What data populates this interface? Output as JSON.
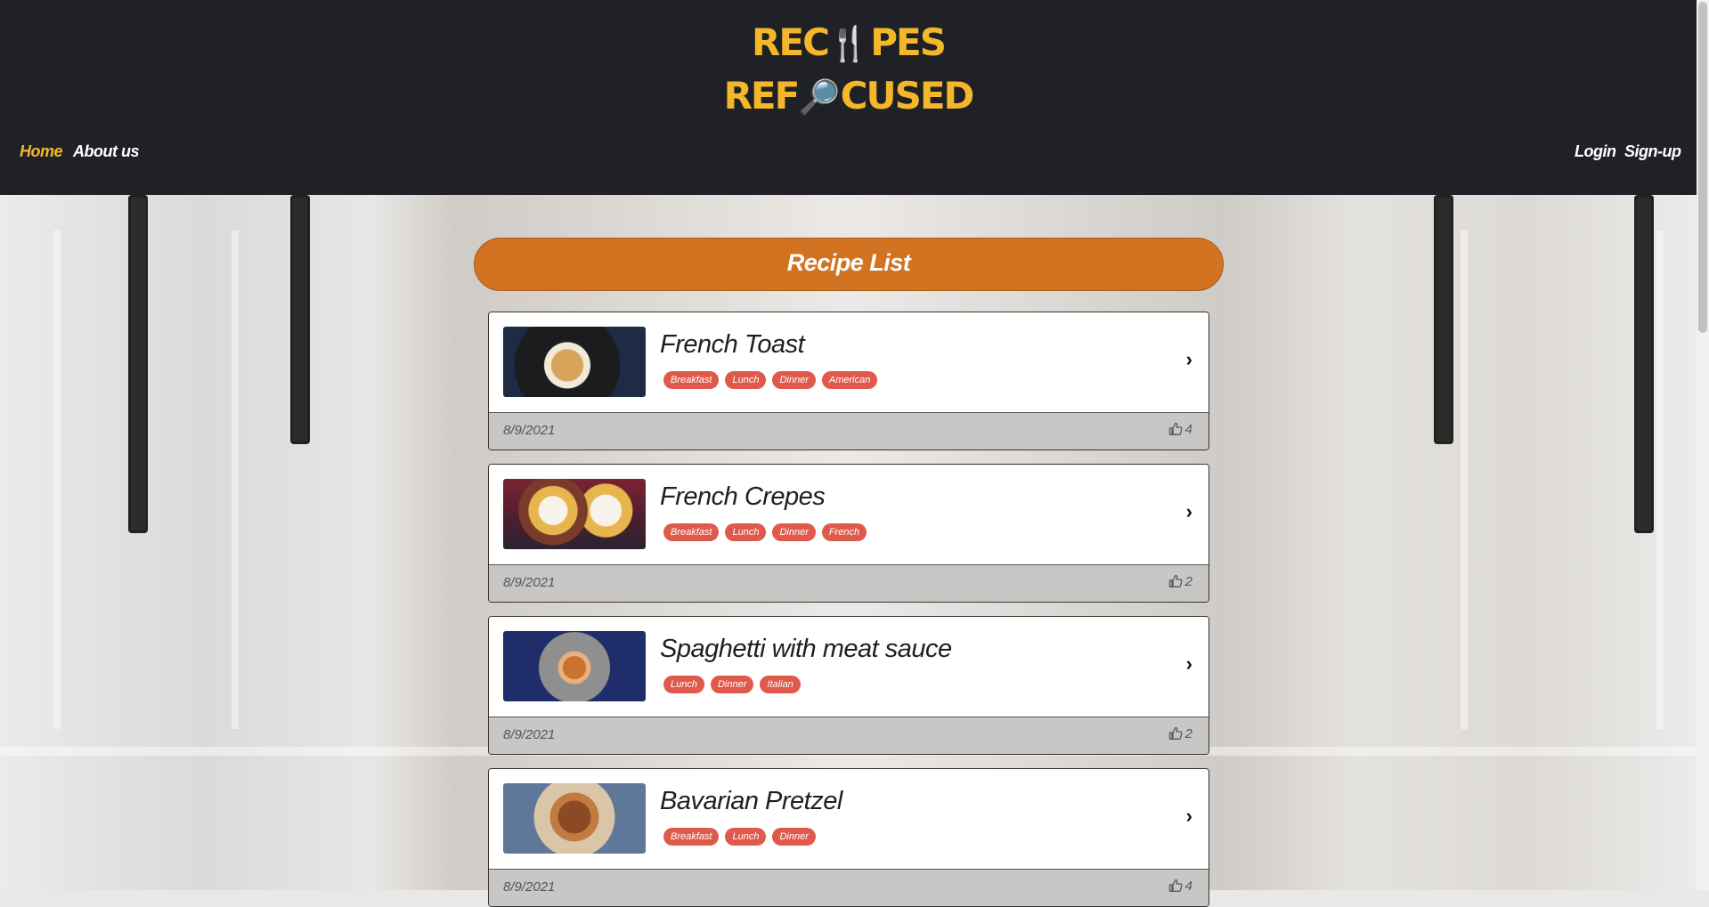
{
  "header": {
    "logo_line1_a": "REC",
    "logo_line1_glyph": "🍴",
    "logo_line1_b": "PES",
    "logo_line2_a": "REF",
    "logo_line2_glyph": "🔎",
    "logo_line2_b": "CUSED"
  },
  "nav": {
    "home": "Home",
    "about": "About us",
    "login": "Login",
    "signup": "Sign-up"
  },
  "main": {
    "heading": "Recipe List",
    "recipes": [
      {
        "title": "French Toast",
        "tags": [
          "Breakfast",
          "Lunch",
          "Dinner",
          "American"
        ],
        "date": "8/9/2021",
        "likes": "4"
      },
      {
        "title": "French Crepes",
        "tags": [
          "Breakfast",
          "Lunch",
          "Dinner",
          "French"
        ],
        "date": "8/9/2021",
        "likes": "2"
      },
      {
        "title": "Spaghetti with meat sauce",
        "tags": [
          "Lunch",
          "Dinner",
          "Italian"
        ],
        "date": "8/9/2021",
        "likes": "2"
      },
      {
        "title": "Bavarian Pretzel",
        "tags": [
          "Breakfast",
          "Lunch",
          "Dinner"
        ],
        "date": "8/9/2021",
        "likes": "4"
      }
    ]
  },
  "colors": {
    "header_bg": "#202126",
    "accent_yellow": "#f4b729",
    "heading_orange": "#d27321",
    "tag_red": "#e05a4c"
  },
  "icons": {
    "chevron": "chevron-right-icon",
    "like": "thumbs-up-icon"
  }
}
